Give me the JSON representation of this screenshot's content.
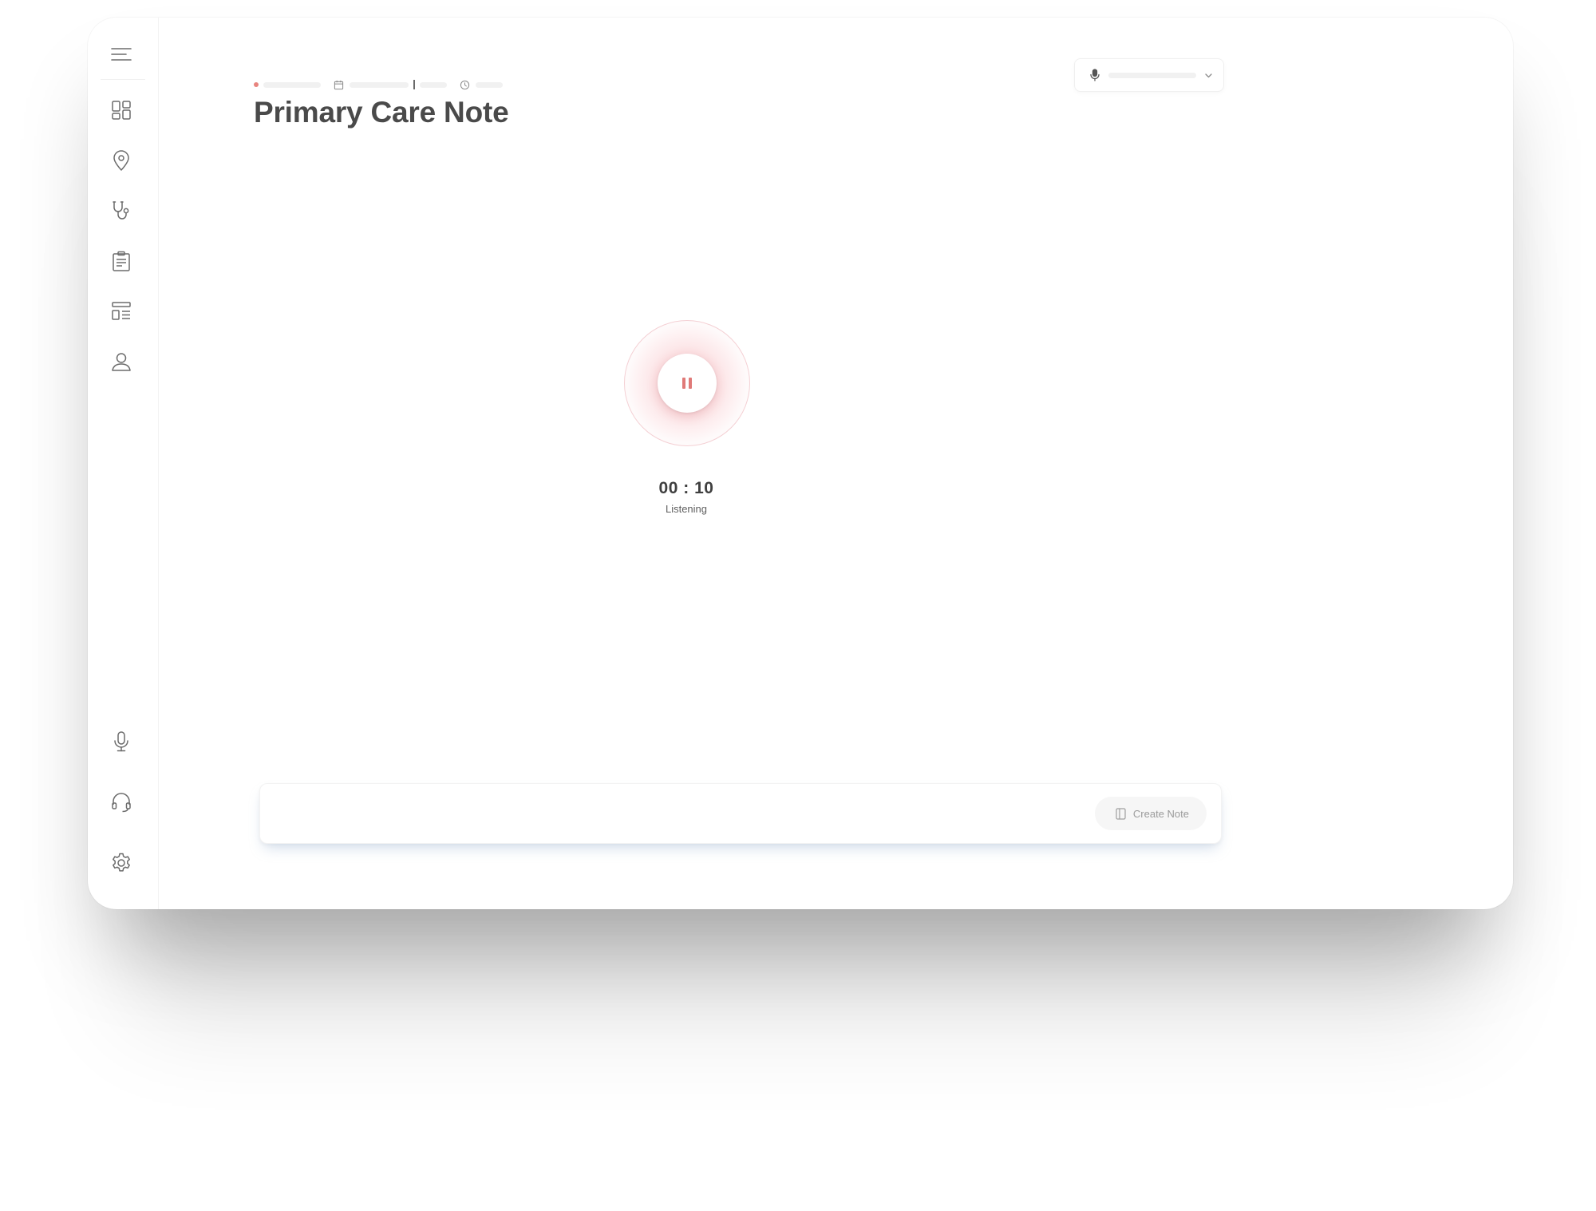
{
  "page": {
    "title": "Primary Care Note"
  },
  "sidebar": {
    "top_items": [
      {
        "name": "menu",
        "icon": "hamburger-menu-icon"
      },
      {
        "name": "dashboard",
        "icon": "dashboard-grid-icon"
      },
      {
        "name": "locations",
        "icon": "map-pin-icon"
      },
      {
        "name": "clinical",
        "icon": "stethoscope-icon"
      },
      {
        "name": "notes",
        "icon": "clipboard-icon"
      },
      {
        "name": "templates",
        "icon": "layout-template-icon"
      },
      {
        "name": "patients",
        "icon": "user-icon"
      }
    ],
    "bottom_items": [
      {
        "name": "dictation",
        "icon": "microphone-icon"
      },
      {
        "name": "support",
        "icon": "headset-icon"
      },
      {
        "name": "settings",
        "icon": "gear-icon"
      }
    ]
  },
  "meta": {
    "status_color": "#e8847e",
    "icons": [
      "calendar-icon",
      "clock-icon"
    ]
  },
  "mic_select": {
    "icon": "microphone-icon",
    "caret_icon": "chevron-down-icon"
  },
  "recorder": {
    "timer": "00 : 10",
    "status": "Listening",
    "accent": "#e07a78",
    "icon": "pause-icon"
  },
  "actions": {
    "create_note_label": "Create Note",
    "create_note_icon": "note-panel-icon"
  }
}
